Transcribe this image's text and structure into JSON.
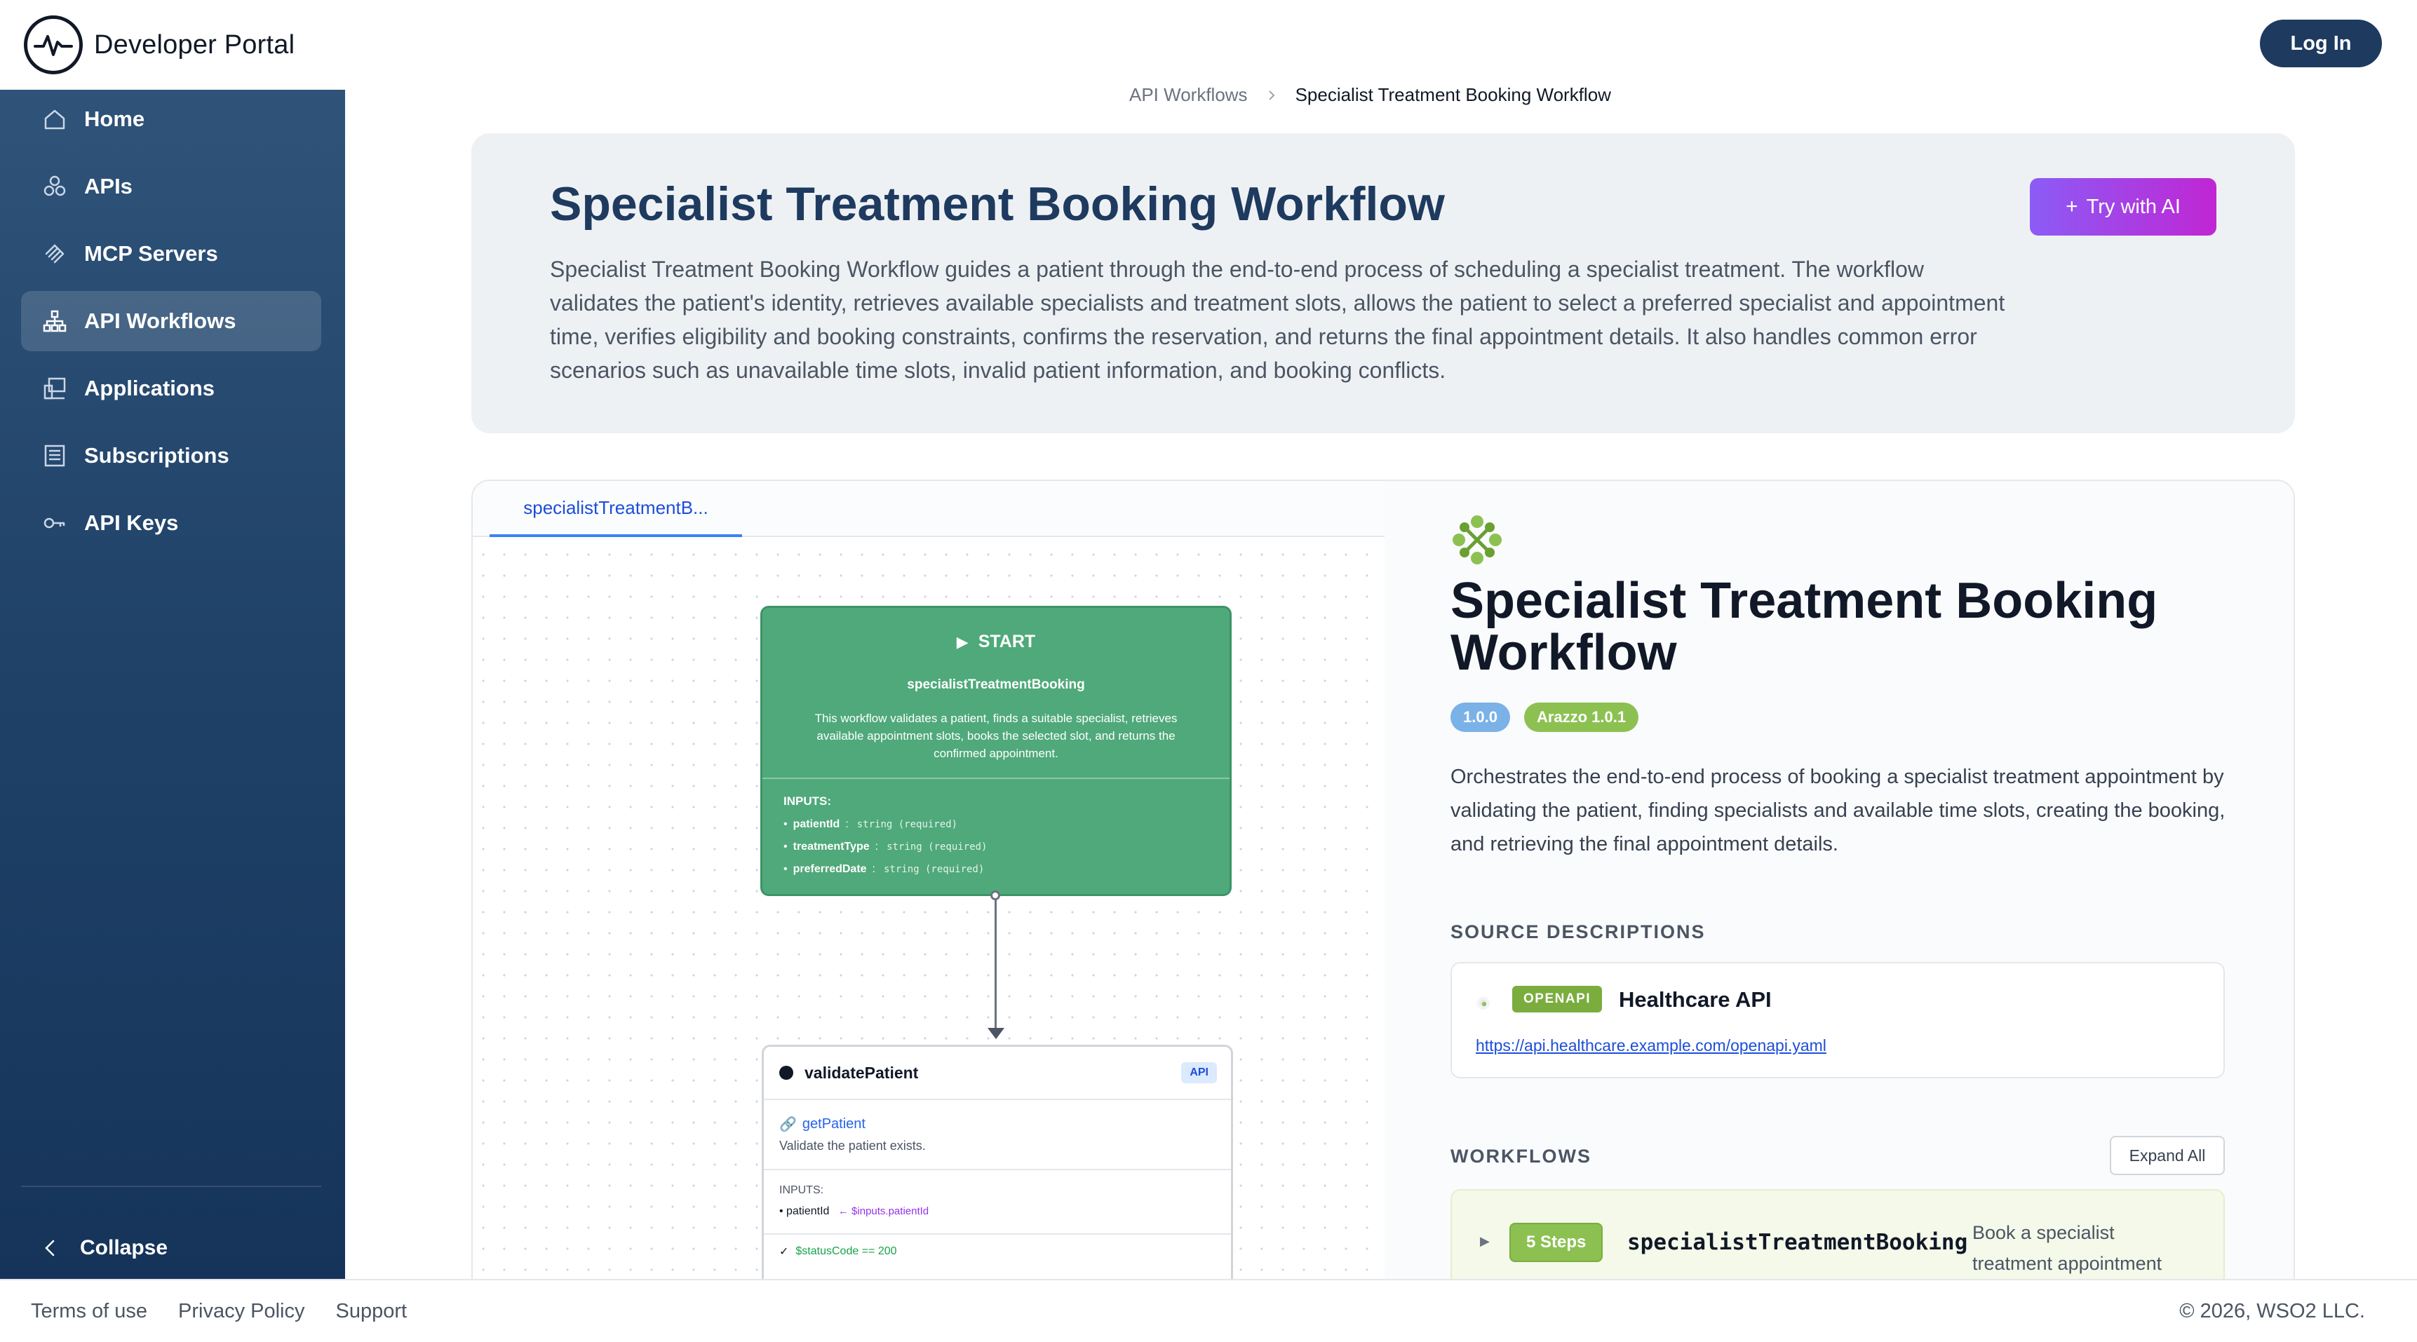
{
  "brand": {
    "name": "Developer Portal"
  },
  "header": {
    "login_label": "Log In"
  },
  "sidebar": {
    "items": [
      {
        "label": "Home",
        "icon": "home-icon"
      },
      {
        "label": "APIs",
        "icon": "apis-icon"
      },
      {
        "label": "MCP Servers",
        "icon": "mcp-icon"
      },
      {
        "label": "API Workflows",
        "icon": "workflow-icon",
        "active": true
      },
      {
        "label": "Applications",
        "icon": "applications-icon"
      },
      {
        "label": "Subscriptions",
        "icon": "subscriptions-icon"
      },
      {
        "label": "API Keys",
        "icon": "key-icon"
      }
    ],
    "collapse_label": "Collapse"
  },
  "breadcrumb": {
    "parent": "API Workflows",
    "current": "Specialist Treatment Booking Workflow"
  },
  "hero": {
    "title": "Specialist Treatment Booking Workflow",
    "description": "Specialist Treatment Booking Workflow guides a patient through the end-to-end process of scheduling a specialist treatment. The workflow validates the patient's identity, retrieves available specialists and treatment slots, allows the patient to select a preferred specialist and appointment time, verifies eligibility and booking constraints, confirms the reservation, and returns the final appointment details. It also handles common error scenarios such as unavailable time slots, invalid patient information, and booking conflicts.",
    "ai_button_label": "Try with AI"
  },
  "canvas": {
    "tab_label": "specialistTreatmentB...",
    "start_node": {
      "heading": "START",
      "workflow_id": "specialistTreatmentBooking",
      "description": "This workflow validates a patient, finds a suitable specialist, retrieves available appointment slots, books the selected slot, and returns the confirmed appointment.",
      "inputs_label": "INPUTS:",
      "inputs": [
        {
          "name": "patientId",
          "type": "string (required)"
        },
        {
          "name": "treatmentType",
          "type": "string (required)"
        },
        {
          "name": "preferredDate",
          "type": "string (required)"
        }
      ]
    },
    "step_node": {
      "title": "validatePatient",
      "badge": "API",
      "operation": "getPatient",
      "operation_desc": "Validate the patient exists.",
      "inputs_label": "INPUTS:",
      "input_name": "patientId",
      "input_ref": "← $inputs.patientId",
      "success_criteria": "$statusCode == 200"
    }
  },
  "details": {
    "title": "Specialist Treatment Booking Workflow",
    "version_badge": "1.0.0",
    "arazzo_badge": "Arazzo 1.0.1",
    "description": "Orchestrates the end-to-end process of booking a specialist treatment appointment by validating the patient, finding specialists and available time slots, creating the booking, and retrieving the final appointment details.",
    "source_section_label": "SOURCE DESCRIPTIONS",
    "source": {
      "type_badge": "OPENAPI",
      "name": "Healthcare API",
      "url": "https://api.healthcare.example.com/openapi.yaml"
    },
    "workflows_section_label": "WORKFLOWS",
    "expand_all_label": "Expand All",
    "workflow": {
      "steps_badge": "5 Steps",
      "id": "specialistTreatmentBooking",
      "summary": "Book a specialist treatment appointment"
    }
  },
  "footer": {
    "links": [
      "Terms of use",
      "Privacy Policy",
      "Support"
    ],
    "copyright": "© 2026, WSO2 LLC."
  },
  "colors": {
    "sidebar_top": "#2f5379",
    "sidebar_bottom": "#163459",
    "primary": "#1e3a5f",
    "start_node": "#4fa97a",
    "accent_green": "#8cc152",
    "ai_gradient_start": "#8b5cf6",
    "ai_gradient_end": "#c026d3"
  }
}
